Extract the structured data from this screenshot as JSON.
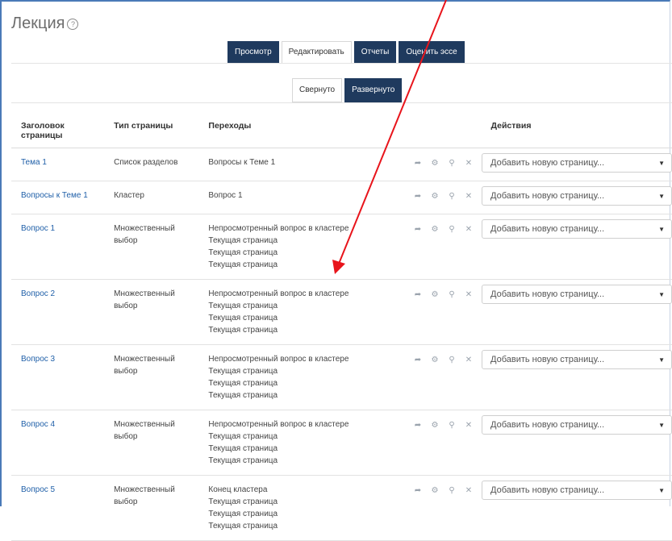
{
  "page": {
    "title": "Лекция",
    "help_icon": "?"
  },
  "tabs": [
    {
      "label": "Просмотр",
      "active": false
    },
    {
      "label": "Редактировать",
      "active": true
    },
    {
      "label": "Отчеты",
      "active": false
    },
    {
      "label": "Оценить эссе",
      "active": false
    }
  ],
  "subtabs": [
    {
      "label": "Свернуто",
      "active": true
    },
    {
      "label": "Развернуто",
      "active": false
    }
  ],
  "table": {
    "headers": [
      "Заголовок страницы",
      "Тип страницы",
      "Переходы",
      "Действия"
    ],
    "select_placeholder": "Добавить новую страницу...",
    "rows": [
      {
        "title": "Тема 1",
        "type": "Список разделов",
        "transitions": [
          "Вопросы к Теме 1"
        ]
      },
      {
        "title": "Вопросы к Теме 1",
        "type": "Кластер",
        "transitions": [
          "Вопрос 1"
        ]
      },
      {
        "title": "Вопрос 1",
        "type": "Множественный выбор",
        "transitions": [
          "Непросмотренный вопрос в кластере",
          "Текущая страница",
          "Текущая страница",
          "Текущая страница"
        ]
      },
      {
        "title": "Вопрос 2",
        "type": "Множественный выбор",
        "transitions": [
          "Непросмотренный вопрос в кластере",
          "Текущая страница",
          "Текущая страница",
          "Текущая страница"
        ]
      },
      {
        "title": "Вопрос 3",
        "type": "Множественный выбор",
        "transitions": [
          "Непросмотренный вопрос в кластере",
          "Текущая страница",
          "Текущая страница",
          "Текущая страница"
        ]
      },
      {
        "title": "Вопрос 4",
        "type": "Множественный выбор",
        "transitions": [
          "Непросмотренный вопрос в кластере",
          "Текущая страница",
          "Текущая страница",
          "Текущая страница"
        ]
      },
      {
        "title": "Вопрос 5",
        "type": "Множественный выбор",
        "transitions": [
          "Конец кластера",
          "Текущая страница",
          "Текущая страница",
          "Текущая страница"
        ]
      }
    ]
  },
  "action_icons": [
    "move-icon",
    "gear-icon",
    "preview-icon",
    "delete-icon"
  ],
  "colors": {
    "nav_dark": "#1f3a5e",
    "link": "#1f5fa8",
    "annotation": "#e8141b"
  }
}
